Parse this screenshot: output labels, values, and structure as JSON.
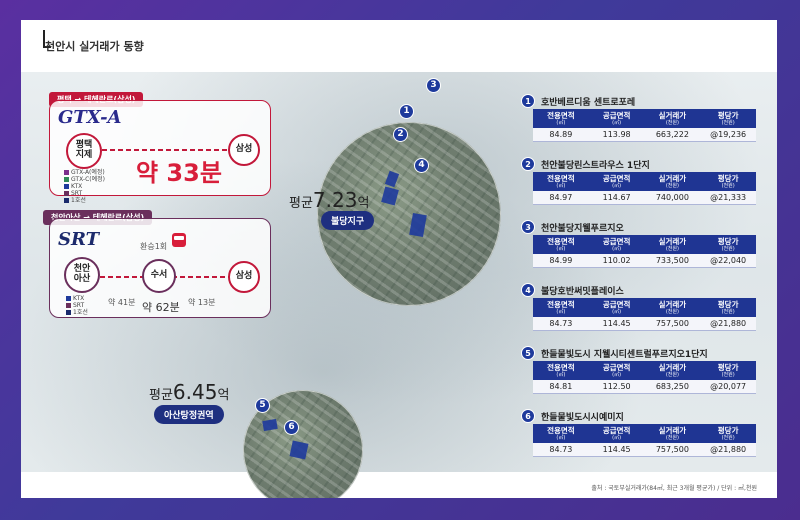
{
  "title": "천안시 실거래가 동향",
  "source": "출처 : 국토부실거래가(84㎡, 최근 3개월 평균가) / 단위 : ㎡,천원",
  "zones": [
    {
      "avg_prefix": "평균",
      "avg_value": "7.23",
      "avg_unit": "억",
      "label": "불당지구"
    },
    {
      "avg_prefix": "평균",
      "avg_value": "6.45",
      "avg_unit": "억",
      "label": "아산탕정권역"
    }
  ],
  "routes": {
    "gtx": {
      "tag": "평택 → 테헤란로(삼성)",
      "logo": "GTX-A",
      "from": "평택\n지제",
      "to": "삼성",
      "time": "약 33분",
      "legend": [
        "GTX-A(예정)",
        "GTX-C(예정)",
        "KTX",
        "SRT",
        "1호선"
      ]
    },
    "srt": {
      "tag": "천안아산 → 테헤란로(삼성)",
      "logo": "SRT",
      "transfer": "환승1회",
      "from": "천안\n아산",
      "via": "수서",
      "to": "삼성",
      "leg1": "약 41분",
      "leg2": "약 13분",
      "total": "약 62분",
      "legend": [
        "KTX",
        "SRT",
        "1호선"
      ]
    }
  },
  "table_headers": [
    {
      "h": "전용면적",
      "u": "(㎡)"
    },
    {
      "h": "공급면적",
      "u": "(㎡)"
    },
    {
      "h": "실거래가",
      "u": "(천원)"
    },
    {
      "h": "평당가",
      "u": "(천원)"
    }
  ],
  "listings": [
    {
      "no": "1",
      "name": "호반베르디움 센트로포레",
      "cols": [
        "84.89",
        "113.98",
        "663,222",
        "@19,236"
      ]
    },
    {
      "no": "2",
      "name": "천안불당린스트라우스 1단지",
      "cols": [
        "84.97",
        "114.67",
        "740,000",
        "@21,333"
      ]
    },
    {
      "no": "3",
      "name": "천안불당지웰푸르지오",
      "cols": [
        "84.99",
        "110.02",
        "733,500",
        "@22,040"
      ]
    },
    {
      "no": "4",
      "name": "불당호반써밋플레이스",
      "cols": [
        "84.73",
        "114.45",
        "757,500",
        "@21,880"
      ]
    },
    {
      "no": "5",
      "name": "한들물빛도시 지웰시티센트럴푸르지오1단지",
      "cols": [
        "84.81",
        "112.50",
        "683,250",
        "@20,077"
      ]
    },
    {
      "no": "6",
      "name": "한들물빛도시시예미지",
      "cols": [
        "84.73",
        "114.45",
        "757,500",
        "@21,880"
      ]
    }
  ],
  "map_pins": [
    "1",
    "2",
    "3",
    "4",
    "5",
    "6"
  ]
}
